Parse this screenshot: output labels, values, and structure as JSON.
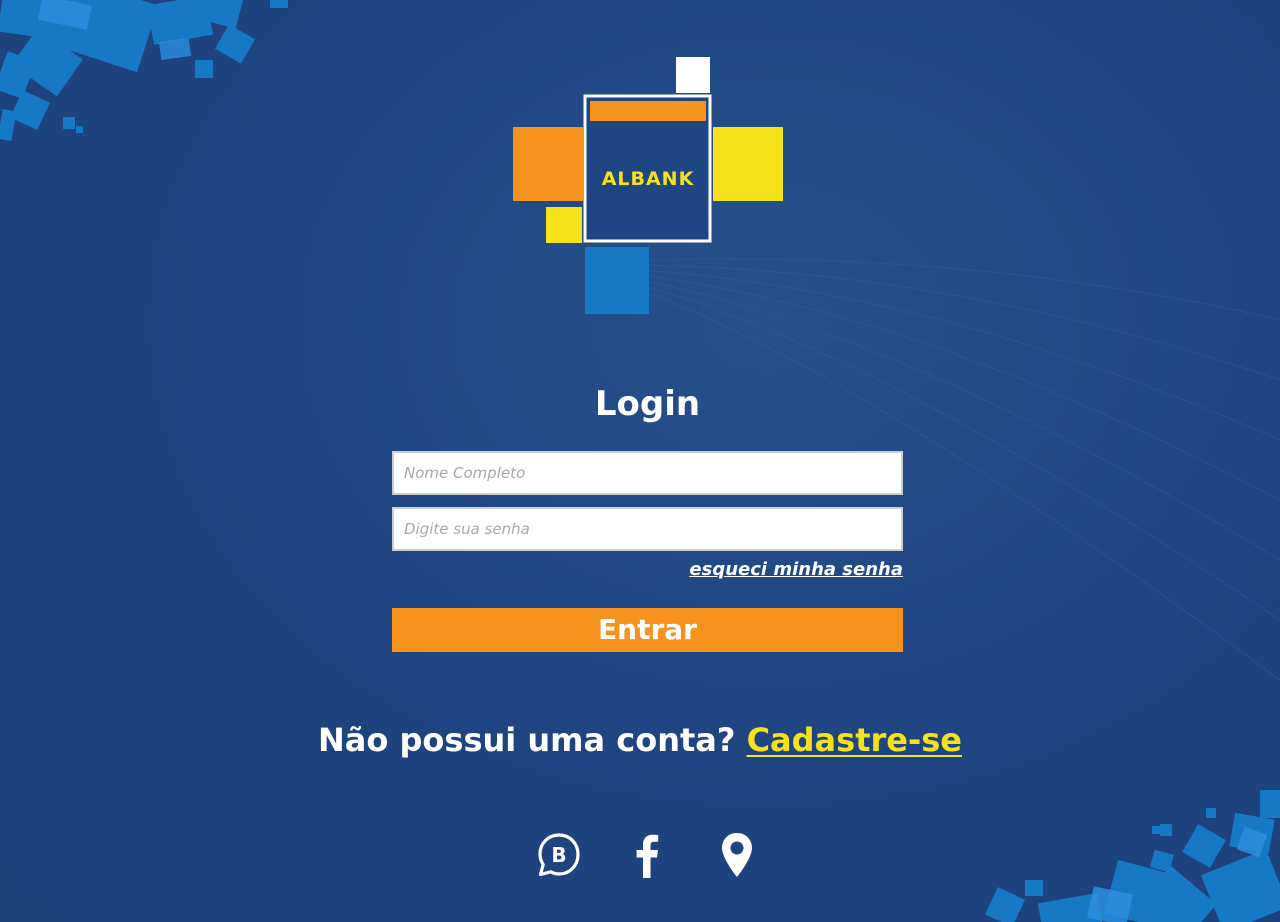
{
  "brand": {
    "logo_text": "ALBANK",
    "colors": {
      "background": "#1f4683",
      "orange": "#f6921e",
      "yellow": "#f5e21a",
      "light_blue": "#1778c4",
      "logo_inner": "#1f4683",
      "white": "#ffffff"
    }
  },
  "login": {
    "title": "Login",
    "name_placeholder": "Nome Completo",
    "password_placeholder": "Digite sua senha",
    "forgot_password_label": "esqueci minha senha",
    "submit_label": "Entrar"
  },
  "signup": {
    "prompt": "Não possui uma conta?",
    "link_label": "Cadastre-se"
  },
  "social": {
    "icons": [
      "whatsapp-icon",
      "facebook-icon",
      "location-pin-icon"
    ]
  }
}
